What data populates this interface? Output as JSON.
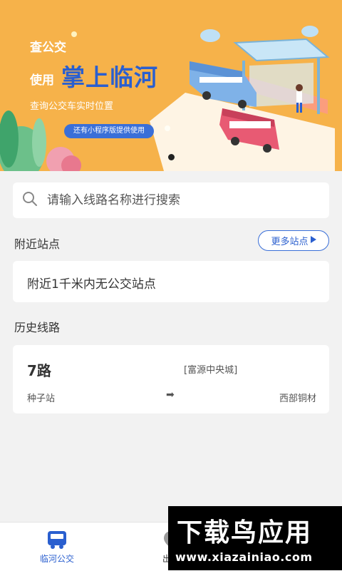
{
  "banner": {
    "line1": "查公交",
    "line2": "使用",
    "big_title": "掌上临河",
    "subtitle": "查询公交车实时位置",
    "pill": "还有小程序版提供使用"
  },
  "search": {
    "placeholder": "请输入线路名称进行搜索"
  },
  "nearby": {
    "title": "附近站点",
    "more_label": "更多站点",
    "empty_text": "附近1千米内无公交站点"
  },
  "history": {
    "title": "历史线路",
    "routes": [
      {
        "name": "7路",
        "note": "[富源中央城]",
        "from": "种子站",
        "to": "西部铜材"
      }
    ]
  },
  "tabbar": {
    "items": [
      {
        "label": "临河公交",
        "icon": "bus-icon",
        "active": true
      },
      {
        "label": "出行",
        "icon": "location-icon",
        "active": false
      }
    ]
  },
  "watermark": {
    "title": "下载鸟应用",
    "url": "www.xiazainiao.com"
  },
  "colors": {
    "accent": "#2a5fcf",
    "banner_bg": "#f6b24a",
    "page_bg": "#f2f2f2"
  }
}
